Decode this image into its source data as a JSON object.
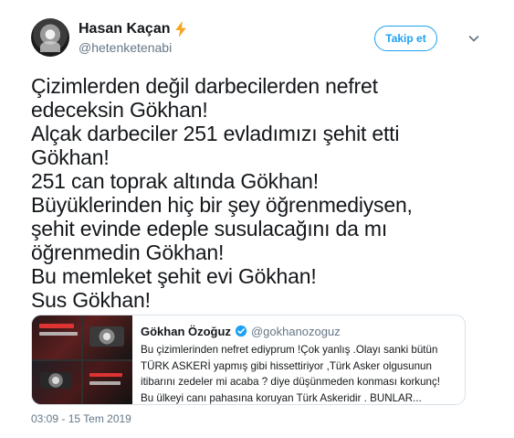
{
  "author": {
    "display_name": "Hasan Kaçan",
    "handle": "@hetenketenabi"
  },
  "follow_button": {
    "label": "Takip et"
  },
  "tweet": {
    "lines": [
      "Çizimlerden değil darbecilerden nefret",
      "edeceksin Gökhan!",
      "Alçak darbeciler 251 evladımızı şehit etti",
      "Gökhan!",
      "251 can toprak altında Gökhan!",
      "Büyüklerinden hiç bir şey öğrenmediysen,",
      "şehit evinde edeple susulacağını da mı",
      "öğrenmedin Gökhan!",
      "Bu memleket şehit evi Gökhan!",
      "Sus Gökhan!"
    ],
    "timestamp": "03:09 - 15 Tem 2019"
  },
  "quoted_tweet": {
    "display_name": "Gökhan Özoğuz",
    "handle": "@gokhanozoguz",
    "text": "Bu çizimlerinden nefret ediyprum !Çok yanlış .Olayı sanki bütün TÜRK ASKERİ yapmış gibi hissettiriyor ,Türk Asker olgusunun itibarını zedeler mi acaba ? diye düşünmeden konması korkunç! Bu ülkeyi canı pahasına koruyan Türk Askeridir . BUNLAR..."
  },
  "icons": {
    "badge": "lightning-bolt-icon",
    "menu": "chevron-down-icon",
    "verified": "verified-badge-icon"
  },
  "colors": {
    "accent": "#1da1f2",
    "bolt": "#f5a623",
    "muted_text": "#657786",
    "text": "#14171a",
    "border": "#d9e1e8"
  }
}
